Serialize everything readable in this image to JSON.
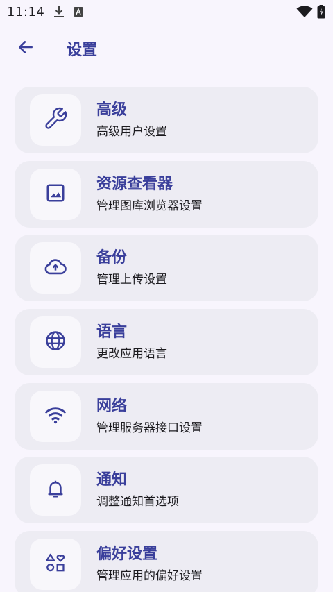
{
  "status_bar": {
    "time": "11:14",
    "icons": [
      "download-icon",
      "a-badge-icon",
      "wifi-icon",
      "battery-icon"
    ]
  },
  "app_bar": {
    "back_icon": "arrow-back-icon",
    "title": "设置"
  },
  "settings": [
    {
      "icon": "wrench-icon",
      "title": "高级",
      "subtitle": "高级用户设置"
    },
    {
      "icon": "image-icon",
      "title": "资源查看器",
      "subtitle": "管理图库浏览器设置"
    },
    {
      "icon": "cloud-upload-icon",
      "title": "备份",
      "subtitle": "管理上传设置"
    },
    {
      "icon": "globe-icon",
      "title": "语言",
      "subtitle": "更改应用语言"
    },
    {
      "icon": "wifi-icon",
      "title": "网络",
      "subtitle": "管理服务器接口设置"
    },
    {
      "icon": "bell-icon",
      "title": "通知",
      "subtitle": "调整通知首选项"
    },
    {
      "icon": "shapes-icon",
      "title": "偏好设置",
      "subtitle": "管理应用的偏好设置"
    }
  ],
  "colors": {
    "accent": "#3a3f9b",
    "background": "#f8f5fd",
    "card": "#edecf3",
    "icon_box": "#f8f7fb"
  }
}
